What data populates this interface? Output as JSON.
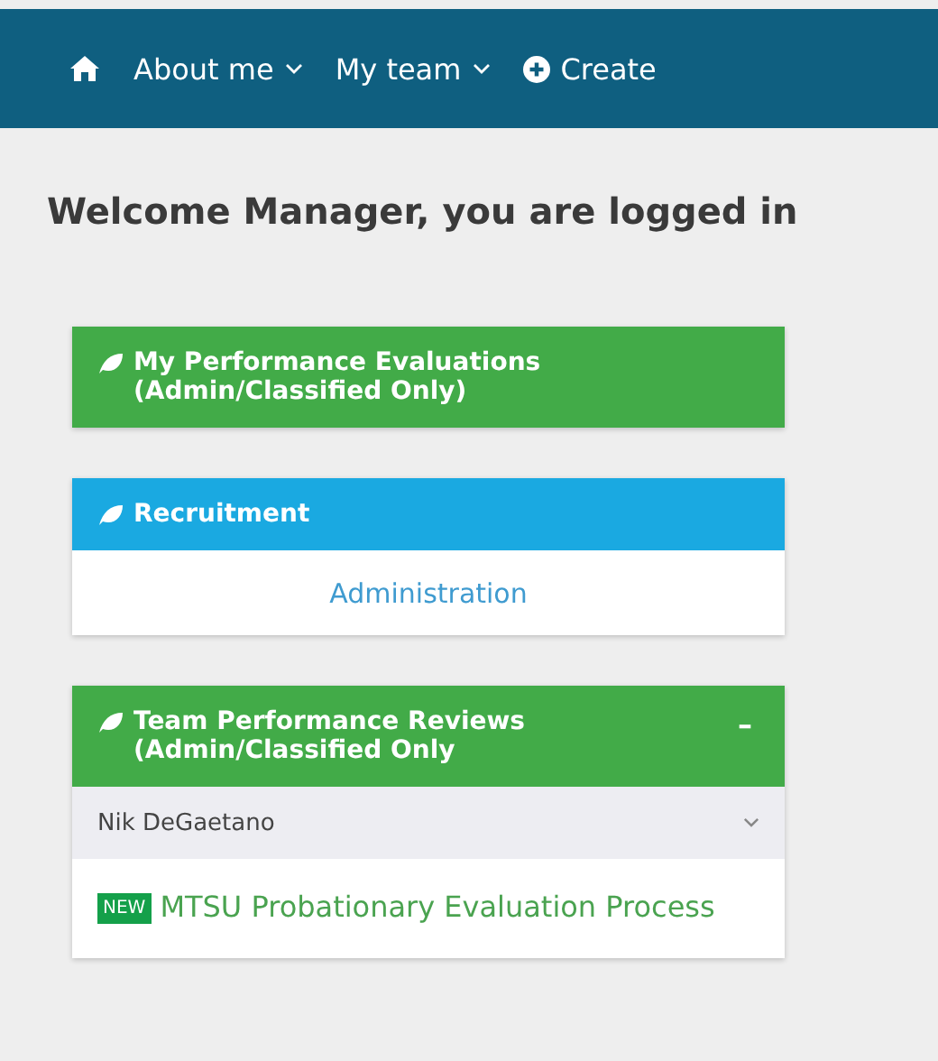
{
  "navbar": {
    "items": [
      {
        "kind": "home"
      },
      {
        "kind": "dropdown",
        "label": "About me"
      },
      {
        "kind": "dropdown",
        "label": "My team"
      },
      {
        "kind": "create",
        "label": "Create"
      }
    ]
  },
  "heading": "Welcome Manager, you are logged in",
  "cards": [
    {
      "title": "My Performance Evaluations (Admin/Classified Only)",
      "color": "#42ab48"
    },
    {
      "title": "Recruitment",
      "color": "#1aa9e1",
      "links": [
        "Administration"
      ]
    },
    {
      "title": "Team Performance Reviews (Admin/Classified Only",
      "color": "#42ab48",
      "expanded": true,
      "collapse_label": "–",
      "select": {
        "value": "Nik DeGaetano"
      },
      "items": [
        {
          "badge": "NEW",
          "label": "MTSU Probationary Evaluation Process"
        }
      ]
    }
  ]
}
